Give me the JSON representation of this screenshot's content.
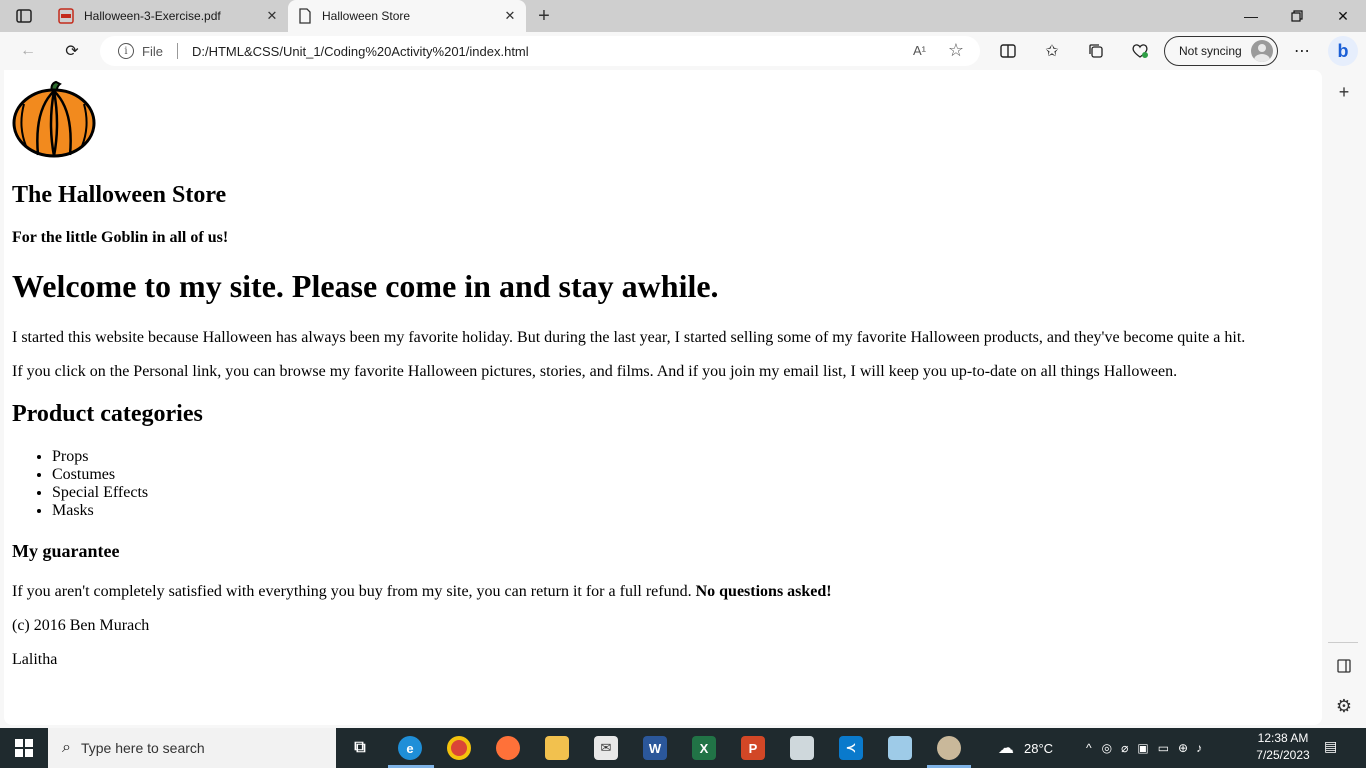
{
  "browser": {
    "tabs": [
      {
        "title": "Halloween-3-Exercise.pdf",
        "active": false,
        "icon": "pdf-icon"
      },
      {
        "title": "Halloween Store",
        "active": true,
        "icon": "document-icon"
      }
    ],
    "address": {
      "scheme_label": "File",
      "url": "D:/HTML&CSS/Unit_1/Coding%20Activity%201/index.html"
    },
    "read_aloud_label": "A¹",
    "sync_label": "Not syncing",
    "bing_label": "b"
  },
  "page": {
    "store_title": "The Halloween Store",
    "tagline": "For the little Goblin in all of us!",
    "welcome": "Welcome to my site. Please come in and stay awhile.",
    "para1": "I started this website because Halloween has always been my favorite holiday. But during the last year, I started selling some of my favorite Halloween products, and they've become quite a hit.",
    "para2": "If you click on the Personal link, you can browse my favorite Halloween pictures, stories, and films. And if you join my email list, I will keep you up-to-date on all things Halloween.",
    "categories_heading": "Product categories",
    "categories": [
      "Props",
      "Costumes",
      "Special Effects",
      "Masks"
    ],
    "guarantee_heading": "My guarantee",
    "guarantee_text": "If you aren't completely satisfied with everything you buy from my site, you can return it for a full refund.",
    "guarantee_bold": "No questions asked!",
    "copyright": "(c) 2016 Ben Murach",
    "author": "Lalitha"
  },
  "taskbar": {
    "search_placeholder": "Type here to search",
    "temperature": "28°C",
    "time": "12:38 AM",
    "date": "7/25/2023",
    "apps": [
      "task-view",
      "edge",
      "chrome",
      "firefox",
      "file-explorer",
      "mail",
      "word",
      "excel",
      "powerpoint",
      "printer",
      "vscode",
      "notepad",
      "paint"
    ]
  },
  "colors": {
    "tabstrip": "#cfcfcf",
    "taskbar": "#1f2a2e",
    "pumpkin": "#f28a1e",
    "accent": "#1b5fd6"
  }
}
